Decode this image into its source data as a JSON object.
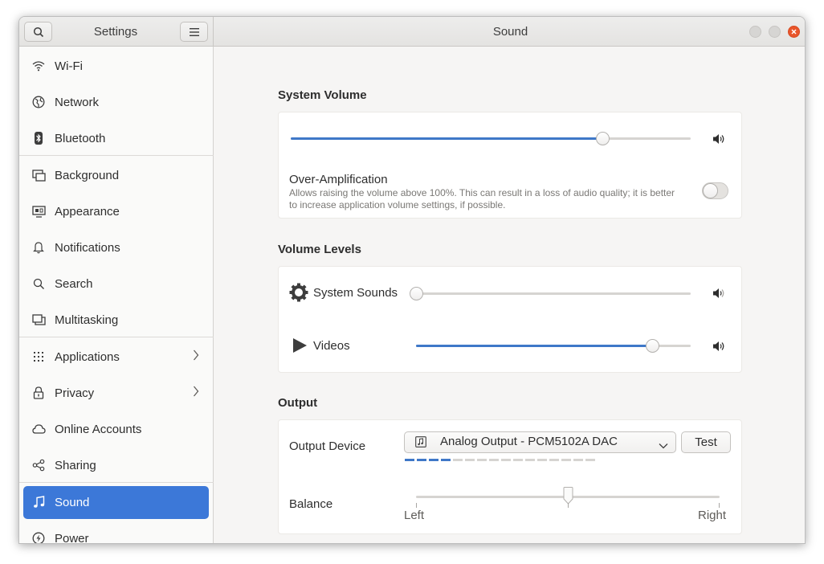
{
  "sidebar_title": "Settings",
  "page_title": "Sound",
  "sidebar": {
    "items": [
      {
        "label": "Wi-Fi",
        "icon": "wifi-icon"
      },
      {
        "label": "Network",
        "icon": "network-icon"
      },
      {
        "label": "Bluetooth",
        "icon": "bluetooth-icon"
      },
      {
        "label": "Background",
        "icon": "background-icon"
      },
      {
        "label": "Appearance",
        "icon": "appearance-icon"
      },
      {
        "label": "Notifications",
        "icon": "bell-icon"
      },
      {
        "label": "Search",
        "icon": "search-icon"
      },
      {
        "label": "Multitasking",
        "icon": "multitasking-icon"
      },
      {
        "label": "Applications",
        "icon": "apps-grid-icon"
      },
      {
        "label": "Privacy",
        "icon": "lock-icon"
      },
      {
        "label": "Online Accounts",
        "icon": "cloud-icon"
      },
      {
        "label": "Sharing",
        "icon": "share-icon"
      },
      {
        "label": "Sound",
        "icon": "music-note-icon"
      },
      {
        "label": "Power",
        "icon": "power-icon"
      }
    ]
  },
  "system_volume": {
    "title": "System Volume",
    "level": 0.78,
    "over_amplification": {
      "label": "Over-Amplification",
      "description_line1": "Allows raising the volume above 100%. This can result in a loss of audio quality; it is better",
      "description_line2": "to increase application volume settings, if possible.",
      "enabled": false
    }
  },
  "volume_levels": {
    "title": "Volume Levels",
    "items": [
      {
        "label": "System Sounds",
        "level": 0.0
      },
      {
        "label": "Videos",
        "level": 0.86
      }
    ]
  },
  "output": {
    "title": "Output",
    "device_label": "Output Device",
    "device_value": "Analog Output - PCM5102A DAC",
    "test_label": "Test",
    "level_segments": 16,
    "level_active": 4,
    "balance_label": "Balance",
    "balance_left": "Left",
    "balance_right": "Right",
    "balance": 0.5
  },
  "colors": {
    "accent": "#3c78d8",
    "slider_fill": "#3f78c8",
    "close_button": "#e9552a"
  }
}
